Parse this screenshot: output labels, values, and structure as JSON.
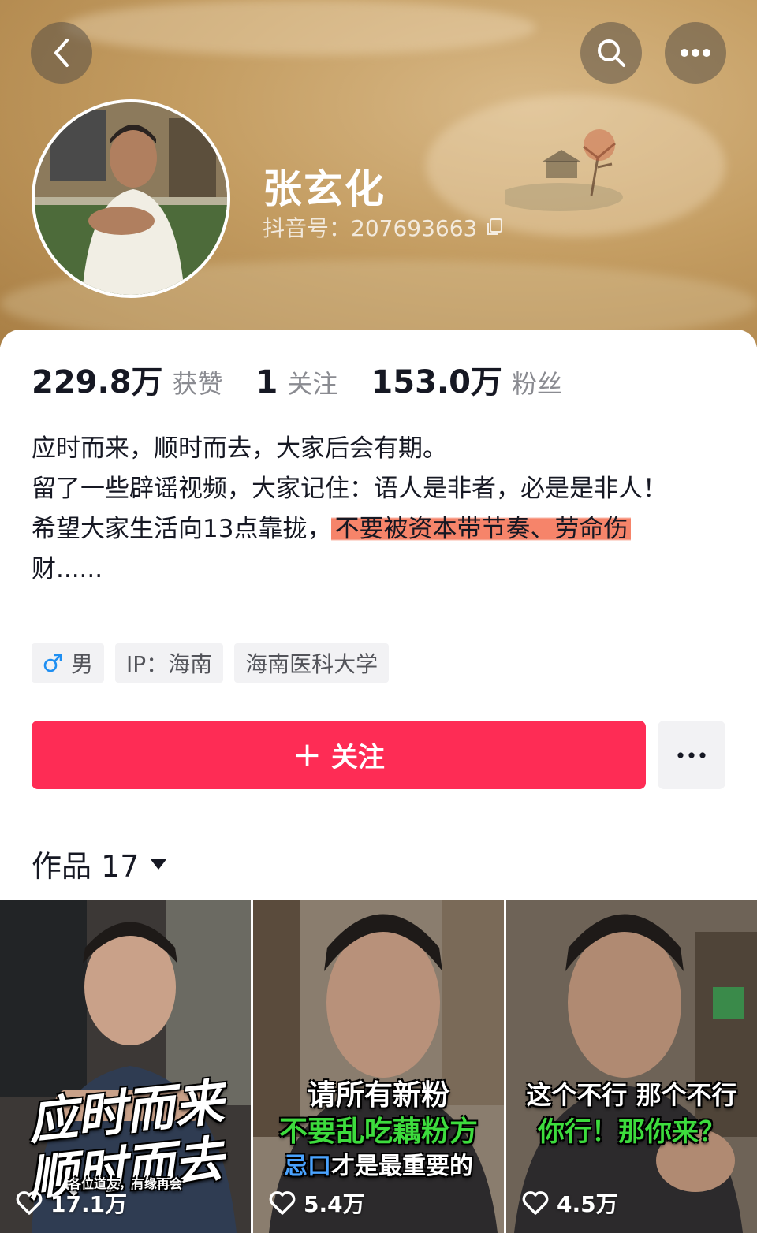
{
  "profile": {
    "name": "张玄化",
    "douyin_id": "抖音号：207693663",
    "stats": [
      {
        "value": "229.8万",
        "label": "获赞"
      },
      {
        "value": "1",
        "label": "关注"
      },
      {
        "value": "153.0万",
        "label": "粉丝"
      }
    ],
    "bio": {
      "line1": "应时而来，顺时而去，大家后会有期。",
      "line2": "留了一些辟谣视频，大家记住：语人是非者，必是是非人！",
      "line3_plain": "希望大家生活向13点靠拢，",
      "line3_highlight": "不要被资本带节奏、劳命伤",
      "line3_tail": "财......"
    },
    "tags": {
      "gender": "男",
      "ip": "IP：海南",
      "school": "海南医科大学"
    }
  },
  "actions": {
    "follow_label": "关注",
    "follow_plus": "+"
  },
  "works": {
    "label": "作品 17"
  },
  "videos": [
    {
      "likes": "17.1万",
      "title_line1": "应时而来",
      "title_line2": "顺时而去",
      "subtitle": "各位道友，有缘再会"
    },
    {
      "likes": "5.4万",
      "caption_line1": "请所有新粉",
      "caption_line2": "不要乱吃藕粉方",
      "caption_line3a": "忌口",
      "caption_line3b": "才是最重要的"
    },
    {
      "likes": "4.5万",
      "caption_line1": "这个不行 那个不行",
      "caption_line2": "你行！那你来？"
    }
  ],
  "colors": {
    "accent": "#fe2c55",
    "header_bg": "#c49d62",
    "highlight": "#f46e50",
    "gender_icon": "#1f8ff2",
    "caption_green": "#3ddc3d",
    "caption_blue": "#4aa3ff"
  },
  "icons": {
    "back": "back-icon",
    "search": "search-icon",
    "more": "more-dots-icon",
    "copy": "copy-icon",
    "male": "male-icon",
    "dropdown": "triangle-down-icon",
    "heart": "heart-icon"
  }
}
